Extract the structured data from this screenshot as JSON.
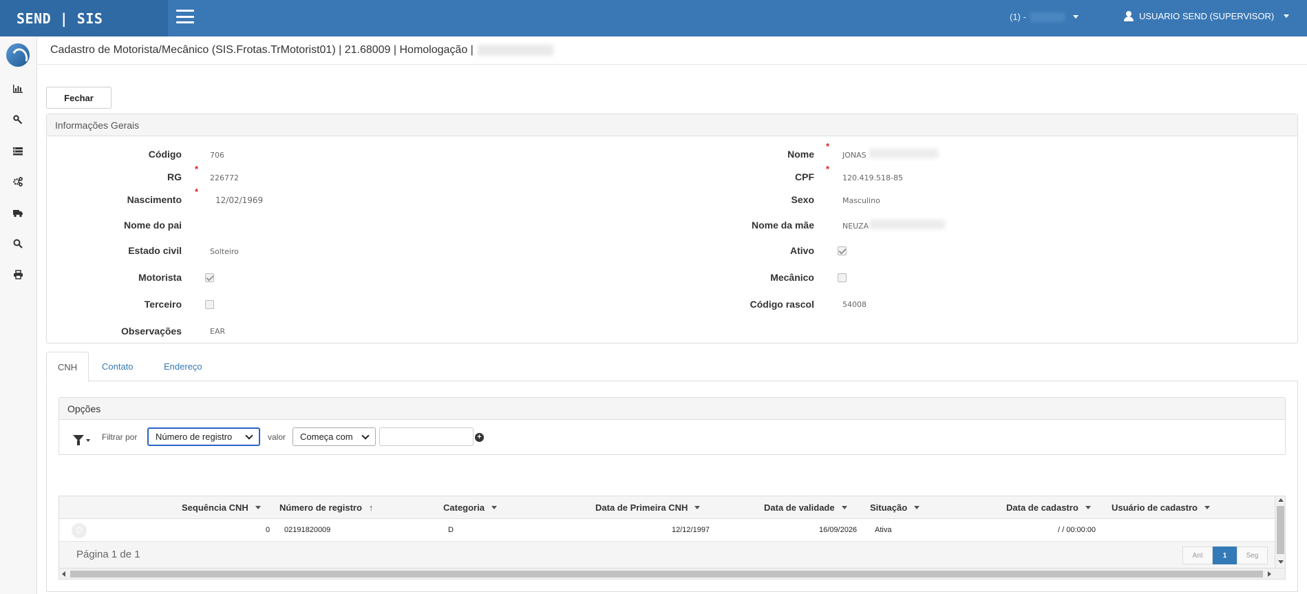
{
  "app": {
    "brand": "SEND | SIS",
    "company_selector": "(1) -",
    "user": "USUARIO SEND (SUPERVISOR)"
  },
  "sidebar": {
    "items": [
      {
        "name": "chart-icon",
        "glyph": "▥"
      },
      {
        "name": "wrench-icon",
        "glyph": "🔧"
      },
      {
        "name": "list-icon",
        "glyph": "☰"
      },
      {
        "name": "gears-icon",
        "glyph": "⚙"
      },
      {
        "name": "truck-icon",
        "glyph": "⛟"
      },
      {
        "name": "search-icon",
        "glyph": "⌕"
      },
      {
        "name": "print-icon",
        "glyph": "⎙"
      }
    ]
  },
  "header": {
    "title": "Cadastro de Motorista/Mecânico (SIS.Frotas.TrMotorist01) | 21.68009 | Homologação |"
  },
  "toolbar": {
    "close_label": "Fechar"
  },
  "general_info": {
    "title": "Informações Gerais",
    "left": {
      "codigo": {
        "label": "Código",
        "value": "706"
      },
      "rg": {
        "label": "RG",
        "value": "226772"
      },
      "nascimento": {
        "label": "Nascimento",
        "value": "12/02/1969"
      },
      "nome_pai": {
        "label": "Nome do pai",
        "value": ""
      },
      "estado_civil": {
        "label": "Estado civil",
        "value": "Solteiro"
      },
      "motorista": {
        "label": "Motorista",
        "checked": true
      },
      "terceiro": {
        "label": "Terceiro",
        "checked": false
      },
      "observacoes": {
        "label": "Observações",
        "value": "EAR"
      }
    },
    "right": {
      "nome": {
        "label": "Nome",
        "value": "JONAS"
      },
      "cpf": {
        "label": "CPF",
        "value": "120.419.518-85"
      },
      "sexo": {
        "label": "Sexo",
        "value": "Masculino"
      },
      "nome_mae": {
        "label": "Nome da mãe",
        "value": "NEUZA"
      },
      "ativo": {
        "label": "Ativo",
        "checked": true
      },
      "mecanico": {
        "label": "Mecânico",
        "checked": false
      },
      "codigo_rascol": {
        "label": "Código rascol",
        "value": "54008"
      }
    },
    "required_mark": "*"
  },
  "tabs": [
    {
      "label": "CNH",
      "active": true
    },
    {
      "label": "Contato",
      "active": false
    },
    {
      "label": "Endereço",
      "active": false
    }
  ],
  "options": {
    "title": "Opções",
    "filter_label": "Filtrar por",
    "filter_value": "Número de registro",
    "value_label": "valor",
    "operator_value": "Começa com",
    "search_value": ""
  },
  "grid": {
    "columns": [
      "Sequência CNH",
      "Número de registro",
      "Categoria",
      "Data de Primeira CNH",
      "Data de validade",
      "Situação",
      "Data de cadastro",
      "Usuário de cadastro"
    ],
    "rows": [
      {
        "sequencia": "0",
        "numero_registro": "02191820009",
        "categoria": "D",
        "data_primeira": "12/12/1997",
        "data_validade": "16/09/2026",
        "situacao": "Ativa",
        "data_cadastro": "/ / 00:00:00",
        "usuario": ""
      }
    ],
    "page_info": "Página 1 de 1",
    "pager": {
      "prev": "Ant",
      "current": "1",
      "next": "Seg"
    }
  }
}
